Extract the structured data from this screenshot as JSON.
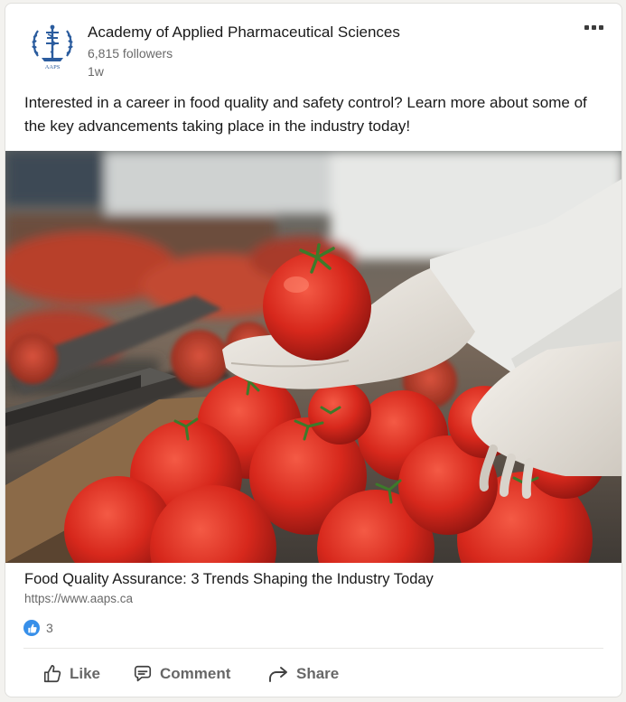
{
  "post": {
    "author": {
      "name": "Academy of Applied Pharmaceutical Sciences",
      "followers": "6,815 followers",
      "age": "1w",
      "logo_icon": "aaps-logo-icon",
      "logo_text": "AAPS"
    },
    "text": "Interested in a career in food quality and safety control? Learn more about some of the key advancements taking place in the industry today!",
    "image": {
      "subject": "gloved-hands-holding-tomato-on-sorting-line"
    },
    "link": {
      "title": "Food Quality Assurance: 3 Trends Shaping the Industry Today",
      "url": "https://www.aaps.ca"
    },
    "reactions": {
      "icon": "like-reaction-icon",
      "count": "3"
    },
    "actions": {
      "like_label": "Like",
      "comment_label": "Comment",
      "share_label": "Share"
    }
  },
  "colors": {
    "like_blue": "#378fe9",
    "logo_navy": "#2b5c9e"
  }
}
